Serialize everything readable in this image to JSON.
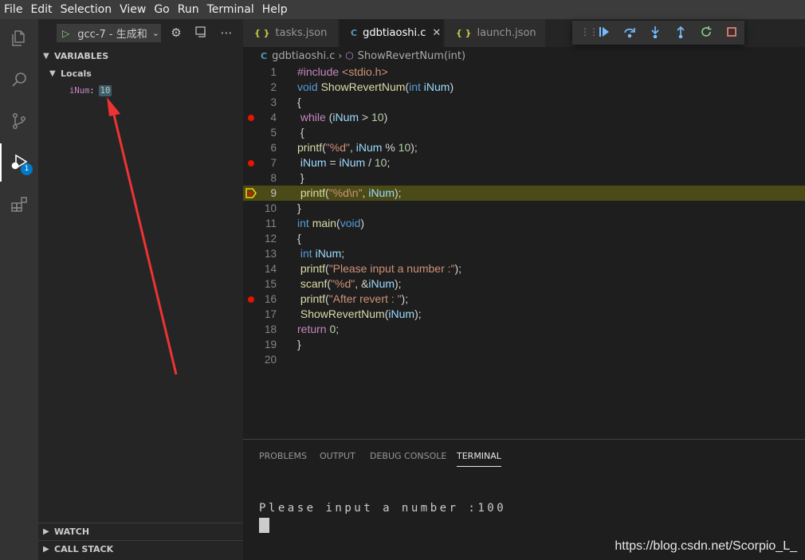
{
  "menu": [
    "File",
    "Edit",
    "Selection",
    "View",
    "Go",
    "Run",
    "Terminal",
    "Help"
  ],
  "activity": {
    "items": [
      "explorer-icon",
      "search-icon",
      "source-control-icon",
      "run-debug-icon",
      "extensions-icon"
    ],
    "debug_badge": "1"
  },
  "sidebar": {
    "config_name": "gcc-7 - 生成和",
    "variables_title": "VARIABLES",
    "locals_title": "Locals",
    "variable": {
      "name": "iNum",
      "value": "10"
    },
    "watch_title": "WATCH",
    "callstack_title": "CALL STACK"
  },
  "tabs": [
    {
      "label": "tasks.json",
      "icon": "{ }"
    },
    {
      "label": "gdbtiaoshi.c",
      "icon": "C",
      "active": true
    },
    {
      "label": "launch.json",
      "icon": "{ }"
    }
  ],
  "breadcrumb": {
    "file": "gdbtiaoshi.c",
    "symbol": "ShowRevertNum(int)"
  },
  "editor": {
    "line_numbers": [
      "1",
      "2",
      "3",
      "4",
      "5",
      "6",
      "7",
      "8",
      "9",
      "10",
      "11",
      "12",
      "13",
      "14",
      "15",
      "16",
      "17",
      "18",
      "19",
      "20"
    ],
    "breakpoint_lines": [
      4,
      7,
      16
    ],
    "current_line": 9
  },
  "panel": {
    "tabs": [
      "PROBLEMS",
      "OUTPUT",
      "DEBUG CONSOLE",
      "TERMINAL"
    ],
    "active_tab": "TERMINAL",
    "terminal_line": "Please input a number :100"
  },
  "watermark": "https://blog.csdn.net/Scorpio_L_",
  "colors": {
    "breakpoint": "#e51400",
    "current_line_bg": "#4b4b18",
    "annotation_arrow": "#ee3333"
  }
}
